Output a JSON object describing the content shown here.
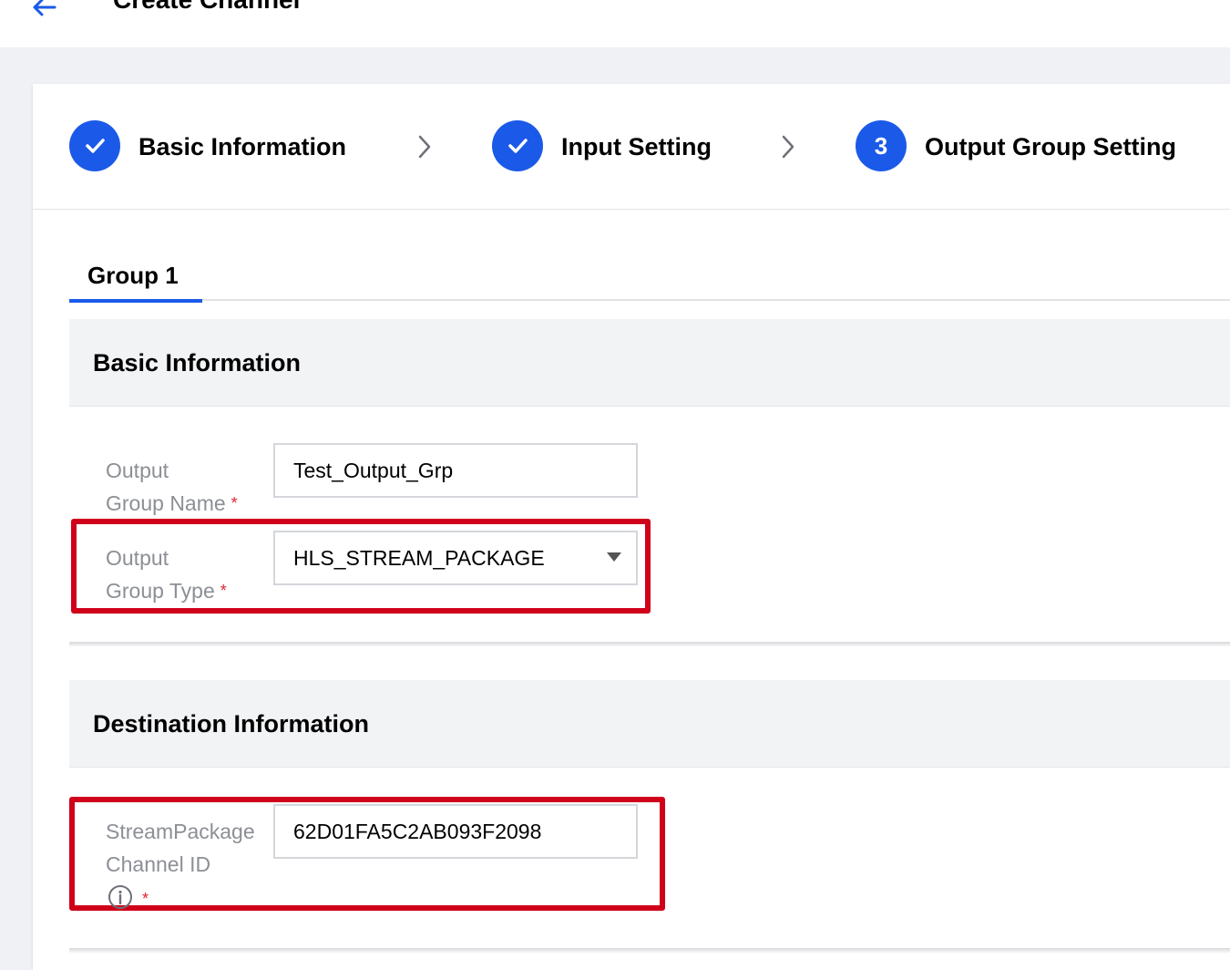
{
  "header": {
    "title": "Create Channel"
  },
  "steps": [
    {
      "label": "Basic Information",
      "state": "done"
    },
    {
      "label": "Input Setting",
      "state": "done"
    },
    {
      "label": "Output Group Setting",
      "state": "active",
      "number": "3"
    }
  ],
  "tabs": [
    {
      "label": "Group 1",
      "active": true
    }
  ],
  "sections": {
    "basic": {
      "title": "Basic Information",
      "output_group_name": {
        "label_line1": "Output",
        "label_line2": "Group Name",
        "required_mark": "*",
        "value": "Test_Output_Grp"
      },
      "output_group_type": {
        "label_line1": "Output",
        "label_line2": "Group Type",
        "required_mark": "*",
        "selected": "HLS_STREAM_PACKAGE"
      }
    },
    "destination": {
      "title": "Destination Information",
      "channel_id": {
        "label_line1": "StreamPackage",
        "label_line2": "Channel ID",
        "required_mark": "*",
        "value": "62D01FA5C2AB093F2098"
      }
    }
  },
  "colors": {
    "accent": "#1b5ae8",
    "highlight": "#d0021b",
    "required": "#e0232e"
  },
  "icons": {
    "back": "arrow-left-icon",
    "done": "check-icon",
    "separator": "chevron-right-icon",
    "dropdown": "caret-down-icon",
    "info": "info-icon"
  }
}
